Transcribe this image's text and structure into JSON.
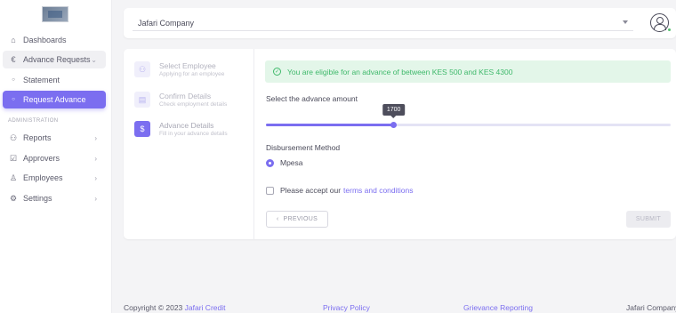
{
  "sidebar": {
    "items": [
      {
        "label": "Dashboards",
        "icon": "home-icon"
      },
      {
        "label": "Advance Requests",
        "icon": "currency-icon"
      },
      {
        "label": "Statement",
        "icon": "circle-icon"
      },
      {
        "label": "Request Advance",
        "icon": "circle-icon"
      },
      {
        "label": "Reports",
        "icon": "reports-icon"
      },
      {
        "label": "Approvers",
        "icon": "approvers-icon"
      },
      {
        "label": "Employees",
        "icon": "person-icon"
      },
      {
        "label": "Settings",
        "icon": "gear-icon"
      }
    ],
    "section_label": "ADMINISTRATION"
  },
  "topbar": {
    "company": "Jafari Company"
  },
  "stepper": {
    "steps": [
      {
        "title": "Select Employee",
        "subtitle": "Applying for an employee"
      },
      {
        "title": "Confirm Details",
        "subtitle": "Check employment details"
      },
      {
        "title": "Advance Details",
        "subtitle": "Fill in your advance details",
        "icon": "$"
      }
    ]
  },
  "form": {
    "eligibility": "You are eligible for an advance of between KES 500 and KES 4300",
    "amount_label": "Select the advance amount",
    "amount_value": "1700",
    "slider_min": 500,
    "slider_max": 4300,
    "slider_value": 1700,
    "disbursement_label": "Disbursement Method",
    "disbursement_option": "Mpesa",
    "terms_prefix": "Please accept our",
    "terms_link": "terms and conditions",
    "prev_label": "PREVIOUS",
    "submit_label": "SUBMIT"
  },
  "footer": {
    "copyright": "Copyright © 2023",
    "brand": "Jafari Credit",
    "privacy": "Privacy Policy",
    "grievance": "Grievance Reporting",
    "company": "Jafari Company"
  },
  "colors": {
    "accent": "#7b6ef0",
    "success": "#3fb96b",
    "success_bg": "#e3f6e9"
  }
}
